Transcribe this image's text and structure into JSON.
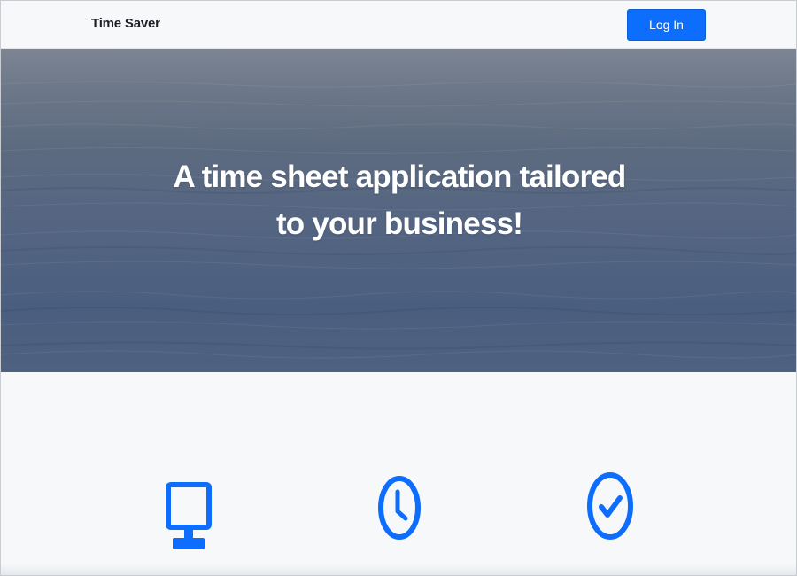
{
  "navbar": {
    "brand": "Time Saver",
    "login_label": "Log In"
  },
  "hero": {
    "title": "A time sheet application tailored to your business!"
  },
  "features": {
    "icons": [
      "monitor-icon",
      "clock-icon",
      "check-circle-icon"
    ]
  },
  "colors": {
    "accent": "#0d6efd",
    "background": "#f7f8fa",
    "hero_water": "#546582"
  }
}
